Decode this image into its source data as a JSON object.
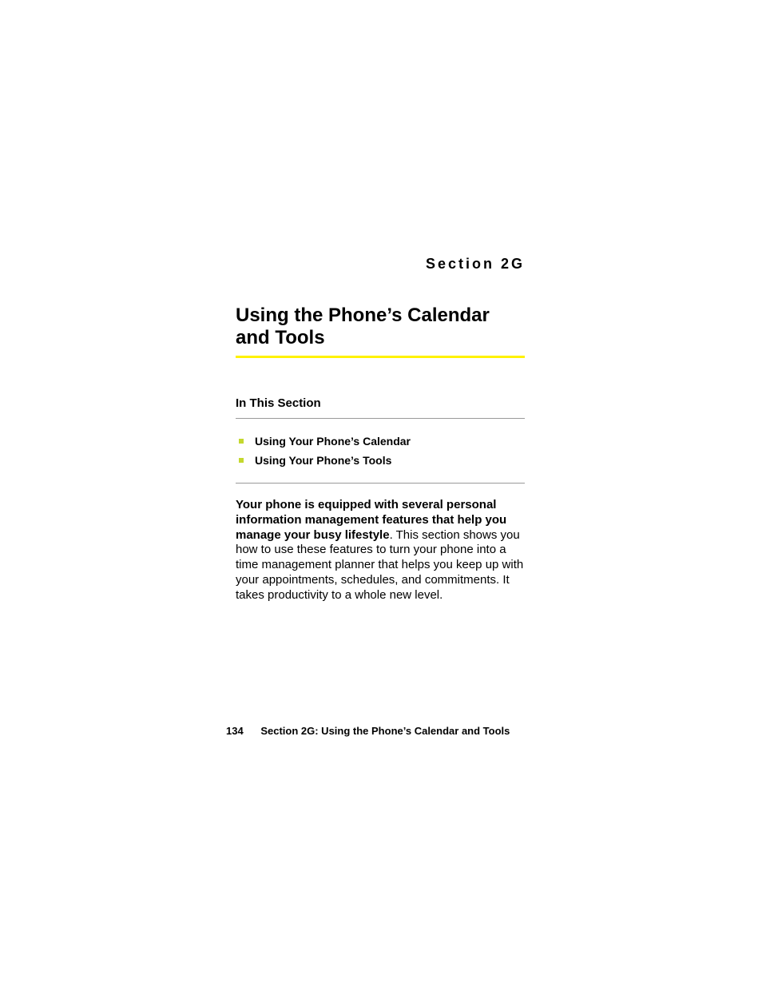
{
  "header": {
    "section_label": "Section 2G"
  },
  "title": "Using the Phone’s Calendar and Tools",
  "toc": {
    "heading": "In This Section",
    "items": [
      {
        "label": "Using Your Phone’s Calendar"
      },
      {
        "label": "Using Your Phone’s Tools"
      }
    ]
  },
  "body": {
    "lead_bold": "Your phone is equipped with several personal information management features that help you manage your busy lifestyle",
    "lead_rest": ". This section shows you how to use these features to turn your phone into a time management planner that helps you keep up with your appointments, schedules, and commitments. It takes productivity to a whole new level."
  },
  "footer": {
    "page_number": "134",
    "running_head": "Section 2G: Using the Phone’s Calendar and Tools"
  }
}
